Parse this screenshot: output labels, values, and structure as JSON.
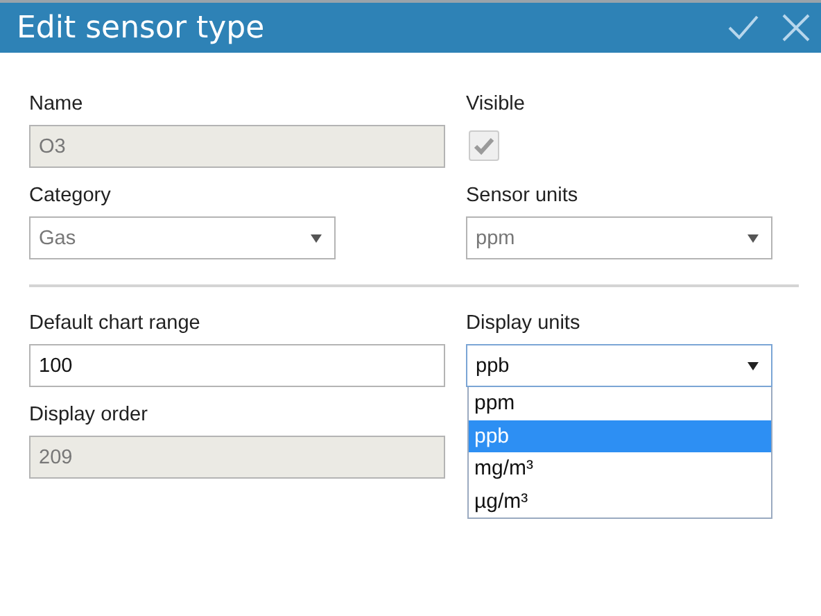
{
  "dialog": {
    "title": "Edit sensor type"
  },
  "title_buttons": [
    {
      "kind": "confirm"
    },
    {
      "kind": "close"
    }
  ],
  "sections": [
    {
      "fields": [
        {
          "label": "Name",
          "kind": "text",
          "value": "O3",
          "disabled": true
        },
        {
          "label": "Visible",
          "kind": "checkbox",
          "checked": true,
          "disabled": true
        },
        {
          "label": "Category",
          "kind": "select",
          "value": "Gas",
          "disabled": true
        },
        {
          "label": "Sensor units",
          "kind": "select",
          "value": "ppm",
          "disabled": true
        }
      ]
    },
    {
      "fields": [
        {
          "label": "Default chart range",
          "kind": "text",
          "value": "100",
          "disabled": false
        },
        {
          "label": "Display units",
          "kind": "select",
          "value": "ppb",
          "disabled": false,
          "expanded": true,
          "options": [
            {
              "label": "ppm",
              "selected": false
            },
            {
              "label": "ppb",
              "selected": true
            },
            {
              "label": "mg/m³",
              "selected": false
            },
            {
              "label": "µg/m³",
              "selected": false
            }
          ]
        },
        {
          "label": "Display order",
          "kind": "text",
          "value": "209",
          "disabled": true
        }
      ]
    }
  ]
}
